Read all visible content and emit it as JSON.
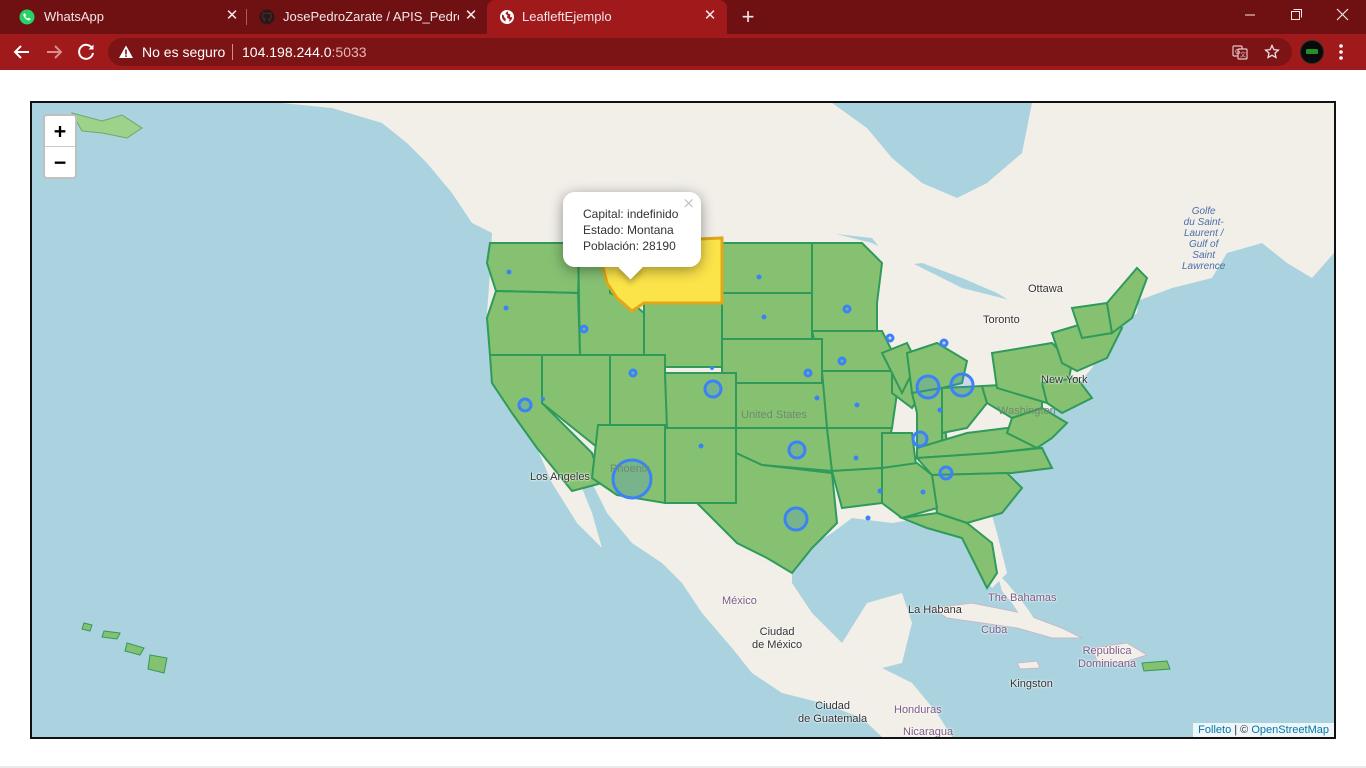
{
  "browser": {
    "tabs": [
      {
        "title": "WhatsApp",
        "icon": "whatsapp-icon",
        "active": false
      },
      {
        "title": "JosePedroZarate / APIS_PedroZar",
        "icon": "github-icon",
        "active": false
      },
      {
        "title": "LeafleftEjemplo",
        "icon": "globe-icon",
        "active": true
      }
    ],
    "new_tab_label": "+",
    "omnibox": {
      "security_text": "No es seguro",
      "host": "104.198.244.0",
      "port": ":5033"
    },
    "colors": {
      "tabstrip": "#6f1113",
      "toolbar": "#a0191b",
      "omnibox": "#7c1416"
    }
  },
  "map": {
    "zoom_in": "+",
    "zoom_out": "−",
    "popup": {
      "capital_line": "Capital: indefinido",
      "state_line": "Estado: Montana",
      "population_line": "Población: 28190",
      "close": "×"
    },
    "labels": {
      "ottawa": "Ottawa",
      "toronto": "Toronto",
      "new_york": "New York",
      "washington": "Washington",
      "united_states": "United States",
      "los_angeles": "Los Angeles",
      "phoenix": "Phoenix",
      "mexico": "México",
      "ciudad_de_mexico": "Ciudad\nde México",
      "la_habana": "La Habana",
      "the_bahamas": "The Bahamas",
      "cuba": "Cuba",
      "republica_dominicana": "República\nDominicana",
      "kingston": "Kingston",
      "ciudad_de_guatemala": "Ciudad\nde Guatemala",
      "honduras": "Honduras",
      "nicaragua": "Nicaragua",
      "gulf": "Golfe\ndu Saint-\nLaurent /\nGulf of\nSaint\nLawrence"
    },
    "attribution": {
      "leaflet": "Folleto",
      "separator": " | © ",
      "osm": "OpenStreetMap"
    },
    "colors": {
      "water": "#aad3df",
      "land": "#f2efe9",
      "state_fill": "#86c172",
      "state_stroke": "#2f9a5a",
      "highlight_fill": "#fbe34a",
      "highlight_stroke": "#e0a817",
      "marker": "#3b82f6"
    }
  }
}
